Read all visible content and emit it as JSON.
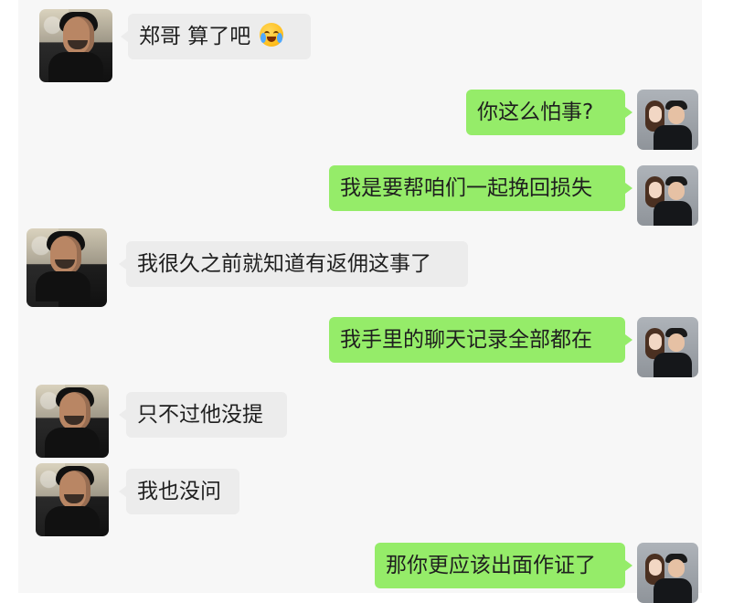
{
  "messages": [
    {
      "side": "left",
      "text": "郑哥  算了吧",
      "emoji": "crying-laughing-emoji-icon"
    },
    {
      "side": "right",
      "text": "你这么怕事?"
    },
    {
      "side": "right",
      "text": "我是要帮咱们一起挽回损失"
    },
    {
      "side": "left",
      "text": "我很久之前就知道有返佣这事了"
    },
    {
      "side": "right",
      "text": "我手里的聊天记录全部都在"
    },
    {
      "side": "left",
      "text": "只不过他没提"
    },
    {
      "side": "left",
      "text": "我也没问"
    },
    {
      "side": "right",
      "text": "那你更应该出面作证了"
    }
  ],
  "colors": {
    "left_bubble": "#ececec",
    "right_bubble": "#95ec69",
    "background": "#f7f7f7"
  }
}
